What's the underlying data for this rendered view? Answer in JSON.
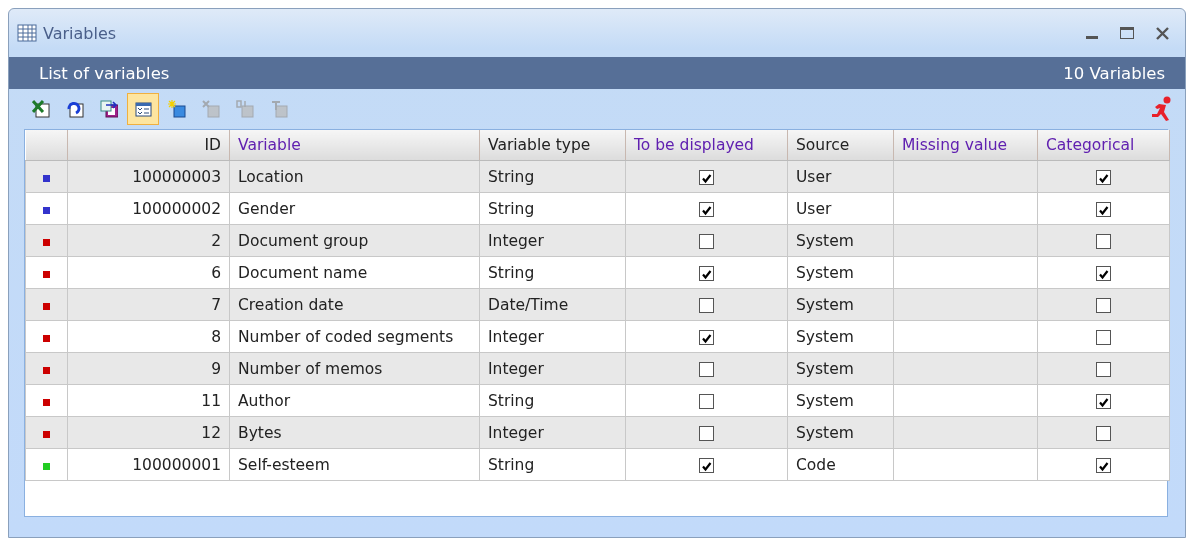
{
  "window": {
    "title": "Variables"
  },
  "header": {
    "title": "List of variables",
    "count": "10 Variables"
  },
  "toolbar": [
    {
      "kind": "excel",
      "selected": false,
      "disabled": false
    },
    {
      "kind": "refresh",
      "selected": false,
      "disabled": false
    },
    {
      "kind": "export",
      "selected": false,
      "disabled": false
    },
    {
      "kind": "checklist",
      "selected": true,
      "disabled": false
    },
    {
      "kind": "new",
      "selected": false,
      "disabled": false
    },
    {
      "kind": "delete",
      "selected": false,
      "disabled": true
    },
    {
      "kind": "convert",
      "selected": false,
      "disabled": true
    },
    {
      "kind": "rename",
      "selected": false,
      "disabled": true
    }
  ],
  "table": {
    "columns": [
      {
        "label": "ID",
        "editable": false
      },
      {
        "label": "Variable",
        "editable": true
      },
      {
        "label": "Variable type",
        "editable": false
      },
      {
        "label": "To be displayed",
        "editable": true
      },
      {
        "label": "Source",
        "editable": false
      },
      {
        "label": "Missing value",
        "editable": true
      },
      {
        "label": "Categorical",
        "editable": true
      }
    ],
    "rows": [
      {
        "color": "#3333cc",
        "id": "100000003",
        "variable": "Location",
        "type": "String",
        "displayed": true,
        "source": "User",
        "categorical": true
      },
      {
        "color": "#3333cc",
        "id": "100000002",
        "variable": "Gender",
        "type": "String",
        "displayed": true,
        "source": "User",
        "categorical": true
      },
      {
        "color": "#cc0000",
        "id": "2",
        "variable": "Document group",
        "type": "Integer",
        "displayed": false,
        "source": "System",
        "categorical": false
      },
      {
        "color": "#cc0000",
        "id": "6",
        "variable": "Document name",
        "type": "String",
        "displayed": true,
        "source": "System",
        "categorical": true
      },
      {
        "color": "#cc0000",
        "id": "7",
        "variable": "Creation date",
        "type": "Date/Time",
        "displayed": false,
        "source": "System",
        "categorical": false
      },
      {
        "color": "#cc0000",
        "id": "8",
        "variable": "Number of coded segments",
        "type": "Integer",
        "displayed": true,
        "source": "System",
        "categorical": false
      },
      {
        "color": "#cc0000",
        "id": "9",
        "variable": "Number of memos",
        "type": "Integer",
        "displayed": false,
        "source": "System",
        "categorical": false
      },
      {
        "color": "#cc0000",
        "id": "11",
        "variable": "Author",
        "type": "String",
        "displayed": false,
        "source": "System",
        "categorical": true
      },
      {
        "color": "#cc0000",
        "id": "12",
        "variable": "Bytes",
        "type": "Integer",
        "displayed": false,
        "source": "System",
        "categorical": false
      },
      {
        "color": "#22cc22",
        "id": "100000001",
        "variable": "Self-esteem",
        "type": "String",
        "displayed": true,
        "source": "Code",
        "categorical": true
      }
    ]
  }
}
